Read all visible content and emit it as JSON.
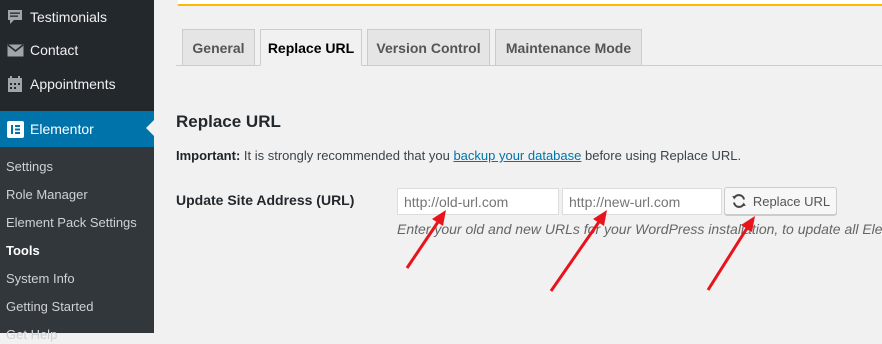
{
  "sidebar": {
    "items": [
      {
        "label": "Testimonials",
        "icon": "testimonial-icon"
      },
      {
        "label": "Contact",
        "icon": "mail-icon"
      },
      {
        "label": "Appointments",
        "icon": "calendar-icon"
      },
      {
        "label": "Elementor",
        "icon": "elementor-icon",
        "active": true
      }
    ],
    "submenu": [
      {
        "label": "Settings"
      },
      {
        "label": "Role Manager"
      },
      {
        "label": "Element Pack Settings"
      },
      {
        "label": "Tools",
        "current": true
      },
      {
        "label": "System Info"
      },
      {
        "label": "Getting Started"
      },
      {
        "label": "Get Help"
      }
    ]
  },
  "tabs": [
    {
      "label": "General"
    },
    {
      "label": "Replace URL",
      "active": true
    },
    {
      "label": "Version Control"
    },
    {
      "label": "Maintenance Mode"
    }
  ],
  "replace_url": {
    "title": "Replace URL",
    "important_label": "Important:",
    "important_text_before": " It is strongly recommended that you ",
    "important_link": "backup your database",
    "important_text_after": " before using Replace URL.",
    "field_label": "Update Site Address (URL)",
    "old_url_placeholder": "http://old-url.com",
    "new_url_placeholder": "http://new-url.com",
    "button_label": "Replace URL",
    "description": "Enter your old and new URLs for your WordPress installation, to update all Elementor data (Relevant for domain transfers or move to 'HTTPS')."
  },
  "colors": {
    "sidebar_bg": "#23282d",
    "submenu_bg": "#32373c",
    "active_blue": "#0073aa",
    "arrow_red": "#e8141b",
    "notice_yellow": "#ffb900"
  }
}
